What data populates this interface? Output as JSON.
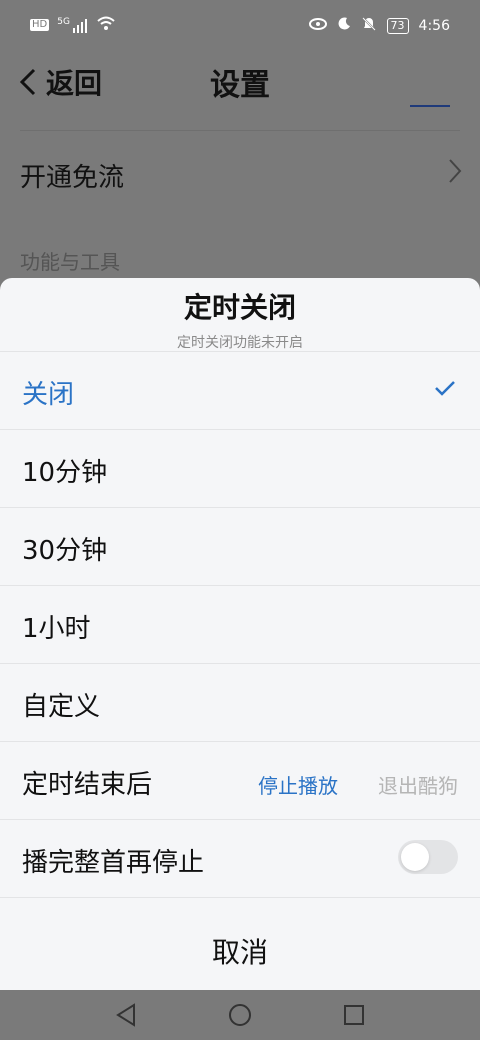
{
  "status_bar": {
    "left_icons": [
      "hd-icon",
      "5g-signal-icon",
      "wifi-icon"
    ],
    "hd_label": "HD",
    "network_label": "5G",
    "right_icons": [
      "eye-icon",
      "moon-icon",
      "mute-bell-icon"
    ],
    "battery": "73",
    "time": "4:56"
  },
  "background_page": {
    "back_label": "返回",
    "title": "设置",
    "row_label": "开通免流",
    "section_title": "功能与工具"
  },
  "sheet": {
    "title": "定时关闭",
    "subtitle": "定时关闭功能未开启",
    "options": [
      {
        "label": "关闭",
        "selected": true
      },
      {
        "label": "10分钟",
        "selected": false
      },
      {
        "label": "30分钟",
        "selected": false
      },
      {
        "label": "1小时",
        "selected": false
      },
      {
        "label": "自定义",
        "selected": false
      }
    ],
    "after_end": {
      "label": "定时结束后",
      "option_active": "停止播放",
      "option_inactive": "退出酷狗"
    },
    "finish_song": {
      "label": "播完整首再停止",
      "enabled": false
    },
    "cancel_label": "取消"
  },
  "colors": {
    "accent": "#2a73c6",
    "overlay": "#7a7a7a",
    "sheet_bg": "#f5f6f8"
  },
  "system_nav": [
    "back-triangle-icon",
    "home-circle-icon",
    "recents-square-icon"
  ]
}
